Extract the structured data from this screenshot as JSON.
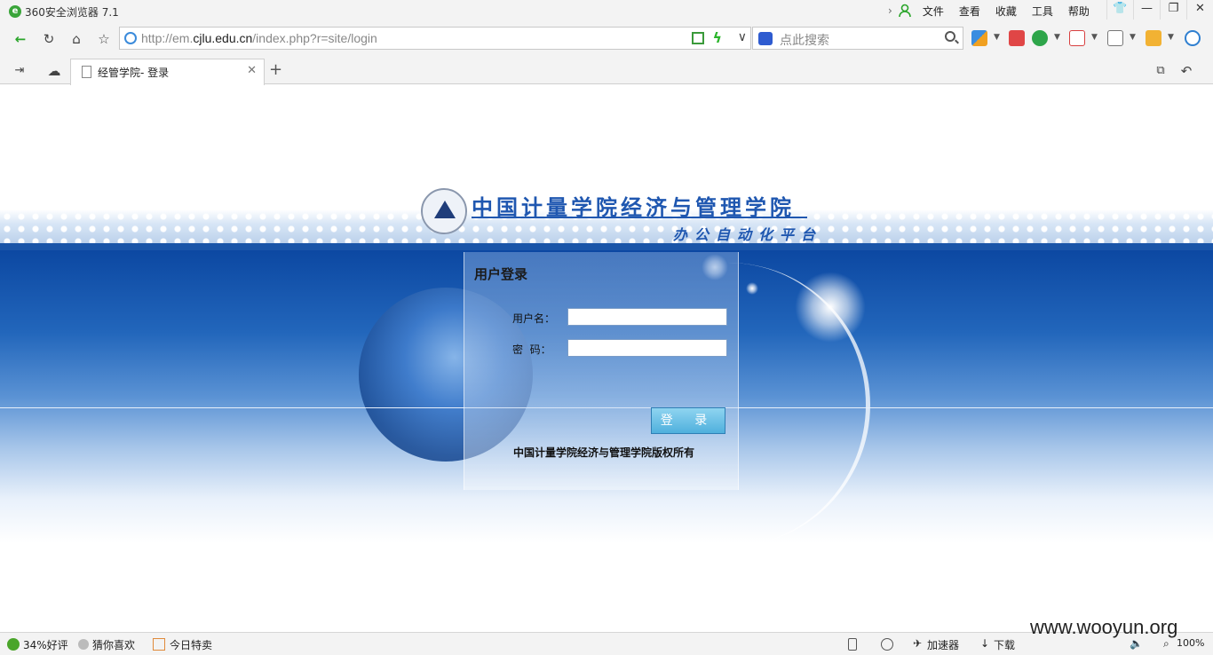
{
  "browser": {
    "title": "360安全浏览器 7.1",
    "menu": [
      "文件",
      "查看",
      "收藏",
      "工具",
      "帮助"
    ],
    "window_buttons": {
      "skin": "👕",
      "minimize": "—",
      "restore": "❐",
      "close": "✕"
    }
  },
  "nav": {
    "url_prefix": "http://em.",
    "url_domain": "cjlu.edu.cn",
    "url_path": "/index.php?r=site/login",
    "search_placeholder": "点此搜索",
    "back": "←",
    "reload": "↻",
    "home": "⌂",
    "favorite": "☆"
  },
  "tabs": [
    {
      "label": "经管学院- 登录",
      "active": true
    }
  ],
  "new_tab": "+",
  "page": {
    "site_title": "中国计量学院经济与管理学院",
    "site_subtitle": "办公自动化平台",
    "login_title": "用户登录",
    "username_label": "用户名：",
    "password_label": "密  码：",
    "username_value": "",
    "password_value": "",
    "login_button": "登 录",
    "copyright": "中国计量学院经济与管理学院版权所有"
  },
  "statusbar": {
    "rating": "34%好评",
    "guess": "猜你喜欢",
    "deals": "今日特卖",
    "accelerator": "加速器",
    "download": "下载",
    "zoom": "100%"
  },
  "watermark": "www.wooyun.org",
  "colors": {
    "brand_blue": "#1f57b0",
    "sky_top": "#0c48a2",
    "chrome_bg": "#f3f3f3"
  }
}
